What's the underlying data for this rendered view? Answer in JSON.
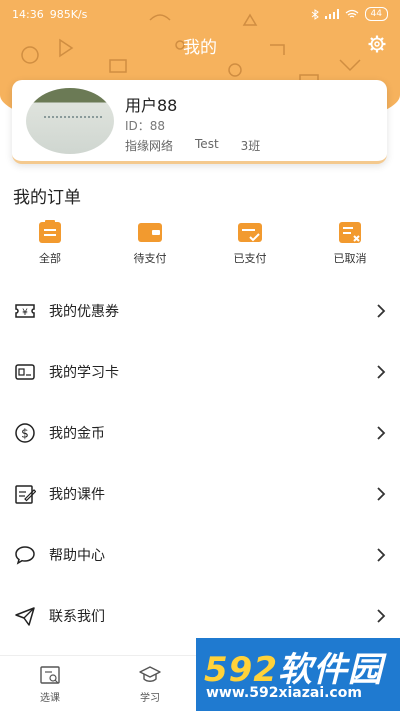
{
  "status_bar": {
    "time": "14:36",
    "speed": "985K/s",
    "battery": "44"
  },
  "header": {
    "title": "我的"
  },
  "profile": {
    "username": "用户88",
    "id_text": "ID：88",
    "org": "指缘网络",
    "group": "Test",
    "class": "3班"
  },
  "orders": {
    "title": "我的订单",
    "items": [
      {
        "label": "全部",
        "icon": "clipboard-icon"
      },
      {
        "label": "待支付",
        "icon": "wallet-icon"
      },
      {
        "label": "已支付",
        "icon": "card-check-icon"
      },
      {
        "label": "已取消",
        "icon": "doc-cancel-icon"
      }
    ]
  },
  "menu": {
    "items": [
      {
        "label": "我的优惠券",
        "icon": "coupon-icon"
      },
      {
        "label": "我的学习卡",
        "icon": "study-card-icon"
      },
      {
        "label": "我的金币",
        "icon": "coin-icon"
      },
      {
        "label": "我的课件",
        "icon": "courseware-icon"
      },
      {
        "label": "帮助中心",
        "icon": "chat-bubble-icon"
      },
      {
        "label": "联系我们",
        "icon": "paper-plane-icon"
      }
    ]
  },
  "bottom_nav": {
    "items": [
      {
        "label": "选课",
        "icon": "course-select-icon"
      },
      {
        "label": "学习",
        "icon": "graduation-cap-icon"
      }
    ]
  },
  "watermark": {
    "logo_num": "592",
    "logo_text": "软件园",
    "url": "www.592xiazai.com"
  },
  "colors": {
    "header": "#f6b25d",
    "accent": "#f29a2f"
  }
}
